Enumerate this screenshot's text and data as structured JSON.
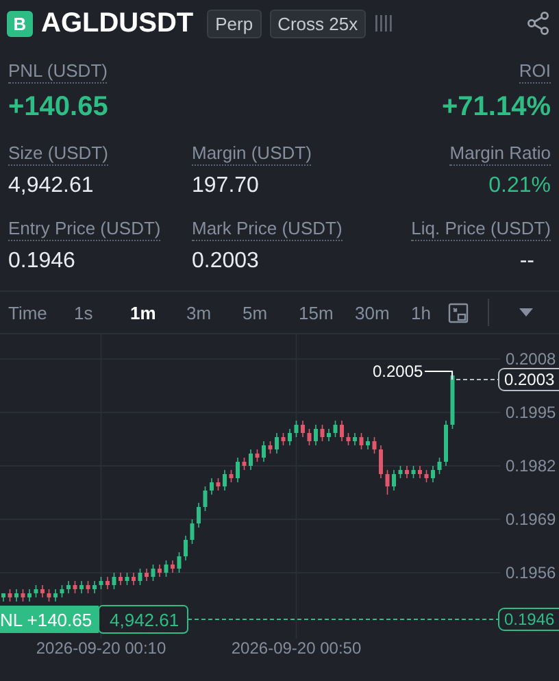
{
  "header": {
    "badge": "B",
    "symbol": "AGLDUSDT",
    "tags": [
      "Perp",
      "Cross 25x"
    ]
  },
  "pnl": {
    "label": "PNL (USDT)",
    "value": "+140.65"
  },
  "roi": {
    "label": "ROI",
    "value": "+71.14%"
  },
  "metrics": [
    {
      "label": "Size (USDT)",
      "value": "4,942.61",
      "positive": false
    },
    {
      "label": "Margin (USDT)",
      "value": "197.70",
      "positive": false
    },
    {
      "label": "Margin Ratio",
      "value": "0.21%",
      "positive": true
    },
    {
      "label": "Entry Price (USDT)",
      "value": "0.1946",
      "positive": false
    },
    {
      "label": "Mark Price (USDT)",
      "value": "0.2003",
      "positive": false
    },
    {
      "label": "Liq. Price (USDT)",
      "value": "--",
      "positive": false
    }
  ],
  "toolbar": {
    "label": "Time",
    "intervals": [
      {
        "label": "1s",
        "selected": false
      },
      {
        "label": "1m",
        "selected": true
      },
      {
        "label": "3m",
        "selected": false
      },
      {
        "label": "5m",
        "selected": false
      },
      {
        "label": "15m",
        "selected": false
      },
      {
        "label": "30m",
        "selected": false
      },
      {
        "label": "1h",
        "selected": false
      }
    ]
  },
  "chart": {
    "last_price": "0.2003",
    "high_label": "0.2005",
    "entry_tag": "0.1946",
    "position_pnl": "NL +140.65",
    "position_size": "4,942.61",
    "time_labels": [
      "2026-09-20 00:10",
      "2026-09-20 00:50"
    ],
    "chart_data": {
      "type": "candlestick",
      "grid": true,
      "ylim": [
        0.194,
        0.2014
      ],
      "yticks": [
        0.2008,
        0.1995,
        0.1982,
        0.1969,
        0.1956
      ],
      "ohlc": [
        [
          0.195,
          0.1951,
          0.1949,
          0.1951
        ],
        [
          0.1951,
          0.1952,
          0.1949,
          0.195
        ],
        [
          0.195,
          0.1952,
          0.1949,
          0.1951
        ],
        [
          0.1951,
          0.1952,
          0.1949,
          0.195
        ],
        [
          0.195,
          0.1952,
          0.1949,
          0.1951
        ],
        [
          0.1951,
          0.1953,
          0.195,
          0.1952
        ],
        [
          0.1952,
          0.1953,
          0.195,
          0.1951
        ],
        [
          0.1951,
          0.1952,
          0.1949,
          0.195
        ],
        [
          0.195,
          0.1952,
          0.1949,
          0.1951
        ],
        [
          0.1951,
          0.1953,
          0.195,
          0.1952
        ],
        [
          0.1952,
          0.1954,
          0.1951,
          0.1953
        ],
        [
          0.1953,
          0.1954,
          0.1951,
          0.1952
        ],
        [
          0.1952,
          0.1954,
          0.1951,
          0.1953
        ],
        [
          0.1953,
          0.1954,
          0.1951,
          0.1952
        ],
        [
          0.1952,
          0.1954,
          0.1951,
          0.1953
        ],
        [
          0.1953,
          0.1955,
          0.1952,
          0.1954
        ],
        [
          0.1954,
          0.1955,
          0.1952,
          0.1953
        ],
        [
          0.1953,
          0.1956,
          0.1952,
          0.1955
        ],
        [
          0.1955,
          0.1956,
          0.1953,
          0.1954
        ],
        [
          0.1954,
          0.1956,
          0.1953,
          0.1955
        ],
        [
          0.1955,
          0.1956,
          0.1953,
          0.1954
        ],
        [
          0.1954,
          0.1957,
          0.1953,
          0.1956
        ],
        [
          0.1956,
          0.1957,
          0.1954,
          0.1955
        ],
        [
          0.1955,
          0.1958,
          0.1954,
          0.1957
        ],
        [
          0.1957,
          0.1958,
          0.1955,
          0.1956
        ],
        [
          0.1956,
          0.1959,
          0.1955,
          0.1958
        ],
        [
          0.1958,
          0.1959,
          0.1956,
          0.1957
        ],
        [
          0.1957,
          0.1961,
          0.1956,
          0.196
        ],
        [
          0.196,
          0.1965,
          0.1959,
          0.1964
        ],
        [
          0.1964,
          0.1969,
          0.1963,
          0.1968
        ],
        [
          0.1968,
          0.1973,
          0.1967,
          0.1972
        ],
        [
          0.1972,
          0.1977,
          0.1971,
          0.1976
        ],
        [
          0.1976,
          0.1979,
          0.1975,
          0.1978
        ],
        [
          0.1978,
          0.1979,
          0.1976,
          0.1977
        ],
        [
          0.1977,
          0.1981,
          0.1976,
          0.198
        ],
        [
          0.198,
          0.1981,
          0.1978,
          0.1979
        ],
        [
          0.1979,
          0.1984,
          0.1978,
          0.1983
        ],
        [
          0.1983,
          0.1984,
          0.1981,
          0.1982
        ],
        [
          0.1982,
          0.1986,
          0.1981,
          0.1985
        ],
        [
          0.1985,
          0.1986,
          0.1983,
          0.1984
        ],
        [
          0.1984,
          0.1988,
          0.1983,
          0.1987
        ],
        [
          0.1987,
          0.1988,
          0.1985,
          0.1986
        ],
        [
          0.1986,
          0.199,
          0.1985,
          0.1989
        ],
        [
          0.1989,
          0.199,
          0.1987,
          0.1988
        ],
        [
          0.1988,
          0.1991,
          0.1987,
          0.199
        ],
        [
          0.199,
          0.1993,
          0.1989,
          0.1992
        ],
        [
          0.1992,
          0.1993,
          0.1989,
          0.199
        ],
        [
          0.199,
          0.1991,
          0.1987,
          0.1988
        ],
        [
          0.1988,
          0.1992,
          0.1987,
          0.1991
        ],
        [
          0.1991,
          0.1992,
          0.1988,
          0.1989
        ],
        [
          0.1989,
          0.1991,
          0.1988,
          0.199
        ],
        [
          0.199,
          0.1993,
          0.1989,
          0.1992
        ],
        [
          0.1992,
          0.1993,
          0.1988,
          0.1989
        ],
        [
          0.1989,
          0.199,
          0.1987,
          0.1988
        ],
        [
          0.1988,
          0.199,
          0.1987,
          0.1989
        ],
        [
          0.1989,
          0.199,
          0.1986,
          0.1987
        ],
        [
          0.1987,
          0.1989,
          0.1986,
          0.1988
        ],
        [
          0.1988,
          0.1989,
          0.1985,
          0.1986
        ],
        [
          0.1986,
          0.1987,
          0.1979,
          0.198
        ],
        [
          0.198,
          0.1981,
          0.1975,
          0.1977
        ],
        [
          0.1977,
          0.1981,
          0.1976,
          0.198
        ],
        [
          0.198,
          0.1982,
          0.1979,
          0.1981
        ],
        [
          0.1981,
          0.1982,
          0.1979,
          0.198
        ],
        [
          0.198,
          0.1982,
          0.1979,
          0.1981
        ],
        [
          0.1981,
          0.1982,
          0.1979,
          0.198
        ],
        [
          0.198,
          0.1981,
          0.1978,
          0.1979
        ],
        [
          0.1979,
          0.1982,
          0.1978,
          0.1981
        ],
        [
          0.1981,
          0.1984,
          0.198,
          0.1983
        ],
        [
          0.1983,
          0.1993,
          0.1982,
          0.1992
        ],
        [
          0.1992,
          0.2005,
          0.1991,
          0.2004
        ]
      ]
    }
  }
}
